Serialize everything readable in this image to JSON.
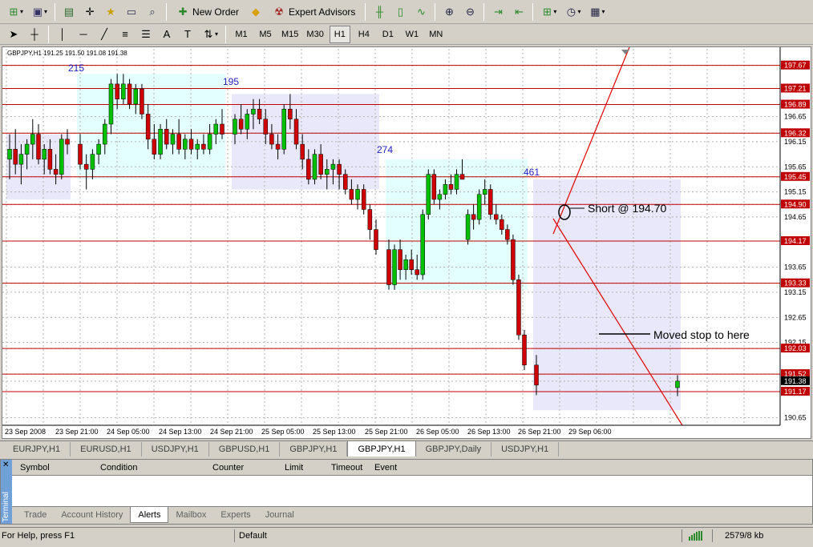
{
  "toolbar1": {
    "new_order_label": "New Order",
    "expert_advisors_label": "Expert Advisors"
  },
  "toolbar2": {
    "timeframes": [
      "M1",
      "M5",
      "M15",
      "M30",
      "H1",
      "H4",
      "D1",
      "W1",
      "MN"
    ],
    "active_timeframe": "H1"
  },
  "chart": {
    "header": "GBPJPY,H1  191.25 191.50 191.08 191.38",
    "price_axis": [
      "197.67",
      "197.21",
      "196.89",
      "196.65",
      "196.32",
      "196.15",
      "195.65",
      "195.45",
      "195.15",
      "194.90",
      "194.65",
      "194.17",
      "193.65",
      "193.33",
      "193.15",
      "192.65",
      "192.15",
      "192.03",
      "191.52",
      "191.38",
      "191.17",
      "190.65"
    ],
    "highlighted_levels": [
      "197.67",
      "197.21",
      "196.89",
      "196.32",
      "195.45",
      "194.90",
      "194.17",
      "193.33",
      "192.03",
      "191.52",
      "191.17"
    ],
    "current_price": "191.38",
    "time_axis": [
      "23 Sep 2008",
      "23 Sep 21:00",
      "24 Sep 05:00",
      "24 Sep 13:00",
      "24 Sep 21:00",
      "25 Sep 05:00",
      "25 Sep 13:00",
      "25 Sep 21:00",
      "26 Sep 05:00",
      "26 Sep 13:00",
      "26 Sep 21:00",
      "29 Sep 06:00"
    ],
    "box_labels": [
      "215",
      "195",
      "274",
      "461"
    ],
    "annotations": {
      "short": "Short @ 194.70",
      "moved_stop": "Moved stop to here"
    },
    "colors": {
      "bull": "#00c000",
      "bear": "#d00000",
      "level_line": "#c00000",
      "box_cyan": "#e0ffff",
      "box_lavender": "#e6e6fa"
    }
  },
  "chart_tabs": [
    "EURJPY,H1",
    "EURUSD,H1",
    "USDJPY,H1",
    "GBPUSD,H1",
    "GBPJPY,H1",
    "GBPJPY,H1",
    "GBPJPY,Daily",
    "USDJPY,H1"
  ],
  "active_chart_tab_index": 5,
  "terminal": {
    "side_label": "Terminal",
    "columns": [
      "Symbol",
      "Condition",
      "Counter",
      "Limit",
      "Timeout",
      "Event"
    ],
    "tabs": [
      "Trade",
      "Account History",
      "Alerts",
      "Mailbox",
      "Experts",
      "Journal"
    ],
    "active_tab": "Alerts"
  },
  "status": {
    "help": "For Help, press F1",
    "profile": "Default",
    "traffic": "2579/8 kb"
  },
  "chart_data": {
    "type": "candlestick",
    "title": "GBPJPY,H1",
    "ylim": [
      190.5,
      198.0
    ],
    "candles": [
      {
        "o": 195.8,
        "h": 196.3,
        "l": 195.4,
        "c": 196.0
      },
      {
        "o": 196.0,
        "h": 196.4,
        "l": 195.5,
        "c": 195.7
      },
      {
        "o": 195.7,
        "h": 196.1,
        "l": 195.3,
        "c": 195.9
      },
      {
        "o": 195.9,
        "h": 196.2,
        "l": 195.6,
        "c": 196.1
      },
      {
        "o": 196.1,
        "h": 196.6,
        "l": 195.8,
        "c": 196.3
      },
      {
        "o": 196.3,
        "h": 196.5,
        "l": 195.7,
        "c": 195.8
      },
      {
        "o": 195.8,
        "h": 196.1,
        "l": 195.5,
        "c": 196.0
      },
      {
        "o": 196.0,
        "h": 196.2,
        "l": 195.5,
        "c": 195.6
      },
      {
        "o": 195.6,
        "h": 195.9,
        "l": 195.3,
        "c": 195.5
      },
      {
        "o": 195.5,
        "h": 196.3,
        "l": 195.4,
        "c": 196.2
      },
      {
        "o": 196.2,
        "h": 196.4,
        "l": 195.9,
        "c": 196.1
      },
      {
        "o": 196.1,
        "h": 196.3,
        "l": 195.6,
        "c": 195.7
      },
      {
        "o": 195.7,
        "h": 195.9,
        "l": 195.2,
        "c": 195.6
      },
      {
        "o": 195.6,
        "h": 196.0,
        "l": 195.4,
        "c": 195.9
      },
      {
        "o": 195.9,
        "h": 196.2,
        "l": 195.7,
        "c": 196.1
      },
      {
        "o": 196.1,
        "h": 196.6,
        "l": 195.9,
        "c": 196.5
      },
      {
        "o": 196.5,
        "h": 197.4,
        "l": 196.3,
        "c": 197.3
      },
      {
        "o": 197.3,
        "h": 197.5,
        "l": 196.8,
        "c": 197.0
      },
      {
        "o": 197.0,
        "h": 197.5,
        "l": 196.9,
        "c": 197.3
      },
      {
        "o": 197.3,
        "h": 197.4,
        "l": 196.8,
        "c": 196.9
      },
      {
        "o": 196.9,
        "h": 197.3,
        "l": 196.7,
        "c": 197.2
      },
      {
        "o": 197.2,
        "h": 197.3,
        "l": 196.6,
        "c": 196.7
      },
      {
        "o": 196.7,
        "h": 196.9,
        "l": 196.0,
        "c": 196.2
      },
      {
        "o": 196.2,
        "h": 196.5,
        "l": 195.8,
        "c": 195.9
      },
      {
        "o": 195.9,
        "h": 196.5,
        "l": 195.8,
        "c": 196.4
      },
      {
        "o": 196.4,
        "h": 196.6,
        "l": 196.0,
        "c": 196.1
      },
      {
        "o": 196.1,
        "h": 196.4,
        "l": 195.9,
        "c": 196.3
      },
      {
        "o": 196.3,
        "h": 196.6,
        "l": 195.9,
        "c": 196.0
      },
      {
        "o": 196.0,
        "h": 196.3,
        "l": 195.8,
        "c": 196.2
      },
      {
        "o": 196.2,
        "h": 196.4,
        "l": 195.9,
        "c": 196.0
      },
      {
        "o": 196.0,
        "h": 196.2,
        "l": 195.8,
        "c": 196.1
      },
      {
        "o": 196.1,
        "h": 196.3,
        "l": 195.9,
        "c": 196.0
      },
      {
        "o": 196.0,
        "h": 196.5,
        "l": 195.9,
        "c": 196.3
      },
      {
        "o": 196.3,
        "h": 196.6,
        "l": 196.1,
        "c": 196.5
      },
      {
        "o": 196.5,
        "h": 196.8,
        "l": 196.2,
        "c": 196.3
      },
      {
        "o": 196.3,
        "h": 196.7,
        "l": 196.1,
        "c": 196.6
      },
      {
        "o": 196.6,
        "h": 196.9,
        "l": 196.3,
        "c": 196.4
      },
      {
        "o": 196.4,
        "h": 196.8,
        "l": 196.2,
        "c": 196.7
      },
      {
        "o": 196.7,
        "h": 197.0,
        "l": 196.4,
        "c": 196.8
      },
      {
        "o": 196.8,
        "h": 197.0,
        "l": 196.5,
        "c": 196.6
      },
      {
        "o": 196.6,
        "h": 196.8,
        "l": 196.1,
        "c": 196.3
      },
      {
        "o": 196.3,
        "h": 196.5,
        "l": 196.0,
        "c": 196.1
      },
      {
        "o": 196.1,
        "h": 196.3,
        "l": 195.8,
        "c": 196.0
      },
      {
        "o": 196.0,
        "h": 196.9,
        "l": 195.9,
        "c": 196.8
      },
      {
        "o": 196.8,
        "h": 197.1,
        "l": 196.4,
        "c": 196.6
      },
      {
        "o": 196.6,
        "h": 196.8,
        "l": 196.0,
        "c": 196.1
      },
      {
        "o": 196.1,
        "h": 196.3,
        "l": 195.6,
        "c": 195.8
      },
      {
        "o": 195.8,
        "h": 196.0,
        "l": 195.3,
        "c": 195.4
      },
      {
        "o": 195.4,
        "h": 196.0,
        "l": 195.3,
        "c": 195.9
      },
      {
        "o": 195.9,
        "h": 196.1,
        "l": 195.4,
        "c": 195.5
      },
      {
        "o": 195.5,
        "h": 195.8,
        "l": 195.2,
        "c": 195.6
      },
      {
        "o": 195.6,
        "h": 195.8,
        "l": 195.3,
        "c": 195.7
      },
      {
        "o": 195.7,
        "h": 195.8,
        "l": 195.2,
        "c": 195.5
      },
      {
        "o": 195.5,
        "h": 195.6,
        "l": 195.1,
        "c": 195.2
      },
      {
        "o": 195.2,
        "h": 195.4,
        "l": 194.9,
        "c": 195.0
      },
      {
        "o": 195.0,
        "h": 195.3,
        "l": 194.8,
        "c": 195.2
      },
      {
        "o": 195.2,
        "h": 195.3,
        "l": 194.7,
        "c": 194.8
      },
      {
        "o": 194.8,
        "h": 194.9,
        "l": 194.2,
        "c": 194.4
      },
      {
        "o": 194.4,
        "h": 194.6,
        "l": 193.9,
        "c": 194.0
      },
      {
        "o": 194.0,
        "h": 194.2,
        "l": 193.2,
        "c": 193.3
      },
      {
        "o": 193.3,
        "h": 194.1,
        "l": 193.2,
        "c": 194.0
      },
      {
        "o": 194.0,
        "h": 194.2,
        "l": 193.4,
        "c": 193.6
      },
      {
        "o": 193.6,
        "h": 193.9,
        "l": 193.4,
        "c": 193.8
      },
      {
        "o": 193.8,
        "h": 194.0,
        "l": 193.5,
        "c": 193.6
      },
      {
        "o": 193.6,
        "h": 193.9,
        "l": 193.4,
        "c": 193.5
      },
      {
        "o": 193.5,
        "h": 194.8,
        "l": 193.4,
        "c": 194.7
      },
      {
        "o": 194.7,
        "h": 195.6,
        "l": 194.6,
        "c": 195.5
      },
      {
        "o": 195.5,
        "h": 195.6,
        "l": 194.9,
        "c": 195.0
      },
      {
        "o": 195.0,
        "h": 195.2,
        "l": 194.8,
        "c": 195.1
      },
      {
        "o": 195.1,
        "h": 195.4,
        "l": 195.0,
        "c": 195.3
      },
      {
        "o": 195.3,
        "h": 195.5,
        "l": 195.1,
        "c": 195.2
      },
      {
        "o": 195.2,
        "h": 195.6,
        "l": 195.1,
        "c": 195.5
      },
      {
        "o": 195.5,
        "h": 195.8,
        "l": 195.4,
        "c": 195.4
      },
      {
        "o": 194.2,
        "h": 194.8,
        "l": 194.1,
        "c": 194.7
      },
      {
        "o": 194.7,
        "h": 194.9,
        "l": 194.4,
        "c": 194.6
      },
      {
        "o": 194.6,
        "h": 195.2,
        "l": 194.5,
        "c": 195.1
      },
      {
        "o": 195.1,
        "h": 195.4,
        "l": 194.9,
        "c": 195.2
      },
      {
        "o": 195.2,
        "h": 195.3,
        "l": 194.6,
        "c": 194.7
      },
      {
        "o": 194.7,
        "h": 194.9,
        "l": 194.5,
        "c": 194.6
      },
      {
        "o": 194.6,
        "h": 194.7,
        "l": 194.3,
        "c": 194.4
      },
      {
        "o": 194.4,
        "h": 194.5,
        "l": 194.1,
        "c": 194.2
      },
      {
        "o": 194.2,
        "h": 194.3,
        "l": 193.3,
        "c": 193.4
      },
      {
        "o": 193.4,
        "h": 193.5,
        "l": 192.2,
        "c": 192.3
      },
      {
        "o": 192.3,
        "h": 192.4,
        "l": 191.6,
        "c": 191.7
      },
      {
        "o": 191.7,
        "h": 191.9,
        "l": 191.1,
        "c": 191.3
      },
      {
        "o": 191.25,
        "h": 191.5,
        "l": 191.08,
        "c": 191.38
      }
    ]
  }
}
